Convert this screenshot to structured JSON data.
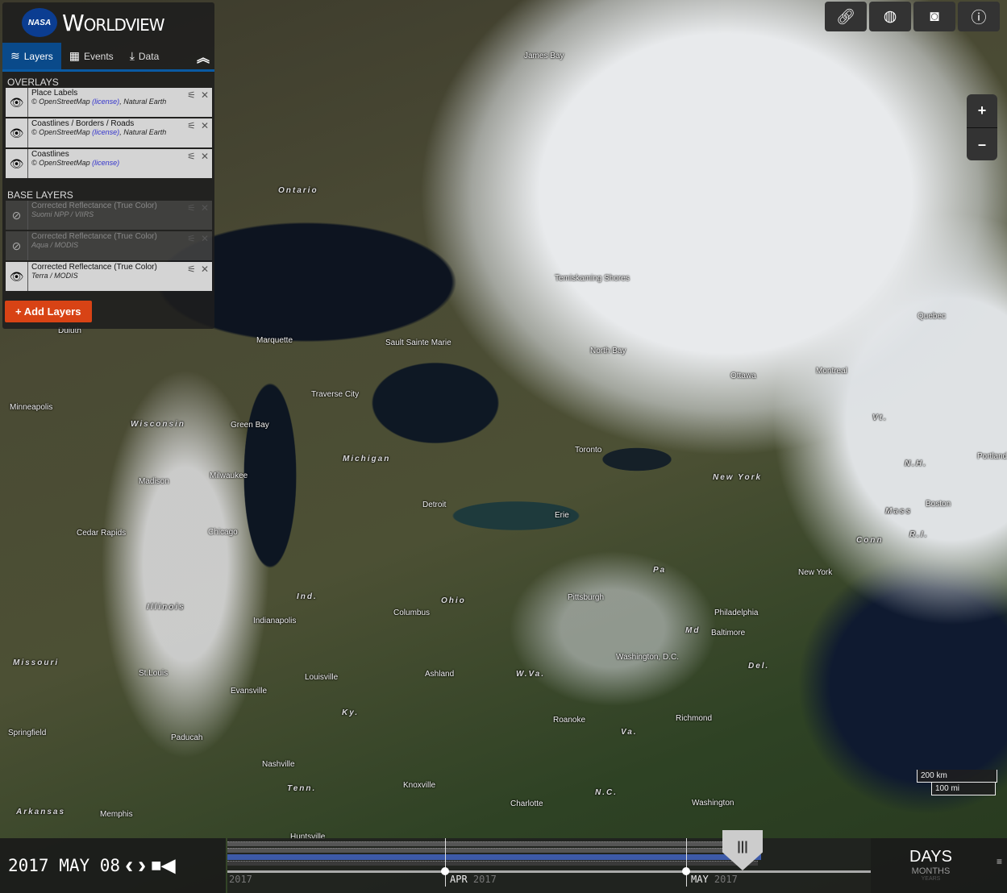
{
  "brand": {
    "logo": "NASA",
    "name": "Worldview"
  },
  "tabs": [
    {
      "label": "Layers",
      "icon": "layers-icon"
    },
    {
      "label": "Events",
      "icon": "calendar-icon"
    },
    {
      "label": "Data",
      "icon": "download-icon"
    }
  ],
  "overlays_title": "OVERLAYS",
  "overlays": [
    {
      "name": "Place Labels",
      "src": "© OpenStreetMap ",
      "lic": "(license)",
      "extra": ", Natural Earth"
    },
    {
      "name": "Coastlines / Borders / Roads",
      "src": "© OpenStreetMap ",
      "lic": "(license)",
      "extra": ", Natural Earth"
    },
    {
      "name": "Coastlines",
      "src": "© OpenStreetMap ",
      "lic": "(license)",
      "extra": ""
    }
  ],
  "base_title": "BASE LAYERS",
  "base": [
    {
      "name": "Corrected Reflectance (True Color)",
      "src": "Suomi NPP / VIIRS",
      "visible": false
    },
    {
      "name": "Corrected Reflectance (True Color)",
      "src": "Aqua / MODIS",
      "visible": false
    },
    {
      "name": "Corrected Reflectance (True Color)",
      "src": "Terra / MODIS",
      "visible": true
    }
  ],
  "add_layers": "+ Add Layers",
  "toolbar": [
    "link-icon",
    "globe-icon",
    "camera-icon",
    "info-icon"
  ],
  "zoom": {
    "in": "+",
    "out": "–"
  },
  "scale": {
    "km": "200 km",
    "mi": "100 mi"
  },
  "timeline": {
    "date": "2017 MAY 08",
    "months": [
      {
        "m": "APR",
        "y": "2017"
      },
      {
        "m": "MAY",
        "y": "2017"
      }
    ],
    "start_year": "2017",
    "zoom_levels": [
      "DAYS",
      "MONTHS",
      "YEARS"
    ],
    "accent": "#3d5aa8"
  },
  "map_labels": [
    "James Bay",
    "Ontario",
    "Temiskaming Shores",
    "Quebec",
    "Marquette",
    "Sault Sainte Marie",
    "North Bay",
    "Ottawa",
    "Montreal",
    "Duluth",
    "Minneapolis",
    "Wisconsin",
    "Green Bay",
    "Traverse City",
    "Vt.",
    "Toronto",
    "Michigan",
    "N.H.",
    "Portland",
    "New York",
    "Madison",
    "Milwaukee",
    "Detroit",
    "Erie",
    "Boston",
    "Mass",
    "Cedar Rapids",
    "Chicago",
    "Conn",
    "R.I.",
    "Pa",
    "New York",
    "Ind.",
    "Ohio",
    "Pittsburgh",
    "Illinois",
    "Columbus",
    "Philadelphia",
    "Indianapolis",
    "Md",
    "Baltimore",
    "Washington, D.C.",
    "Missouri",
    "Del.",
    "St.Louis",
    "Ashland",
    "W.Va.",
    "Louisville",
    "Evansville",
    "Ky.",
    "Roanoke",
    "Richmond",
    "Springfield",
    "Va.",
    "Paducah",
    "Nashville",
    "Tenn.",
    "Knoxville",
    "N.C.",
    "Charlotte",
    "Washington",
    "Arkansas",
    "Memphis",
    "Huntsville"
  ]
}
